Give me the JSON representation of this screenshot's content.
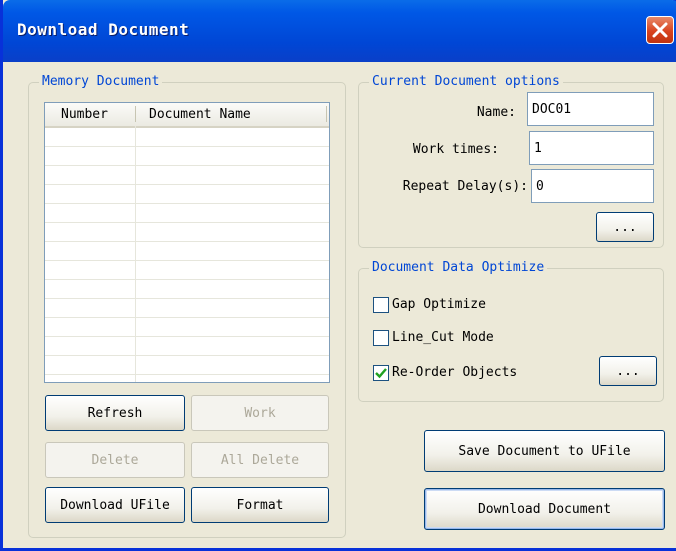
{
  "window": {
    "title": "Download Document"
  },
  "memory_group": {
    "legend": "Memory Document",
    "columns": [
      "Number",
      "Document Name"
    ],
    "rows": [],
    "buttons": {
      "refresh": "Refresh",
      "work": "Work",
      "delete": "Delete",
      "all_delete": "All Delete",
      "download_ufile": "Download UFile",
      "format": "Format"
    }
  },
  "options_group": {
    "legend": "Current Document options",
    "name_label": "Name:",
    "name_value": "DOC01",
    "work_times_label": "Work times:",
    "work_times_value": "1",
    "repeat_delay_label": "Repeat Delay(s):",
    "repeat_delay_value": "0",
    "more_button": "..."
  },
  "optimize_group": {
    "legend": "Document Data Optimize",
    "gap_optimize": {
      "label": "Gap Optimize",
      "checked": false
    },
    "line_cut_mode": {
      "label": "Line_Cut Mode",
      "checked": false
    },
    "re_order_objects": {
      "label": "Re-Order Objects",
      "checked": true
    },
    "more_button": "..."
  },
  "actions": {
    "save_to_ufile": "Save Document to UFile",
    "download_document": "Download Document"
  },
  "colors": {
    "title_bar": "#0054e3",
    "legend_text": "#0046d5",
    "close_button": "#d8431f",
    "dialog_bg": "#ece9d8"
  }
}
